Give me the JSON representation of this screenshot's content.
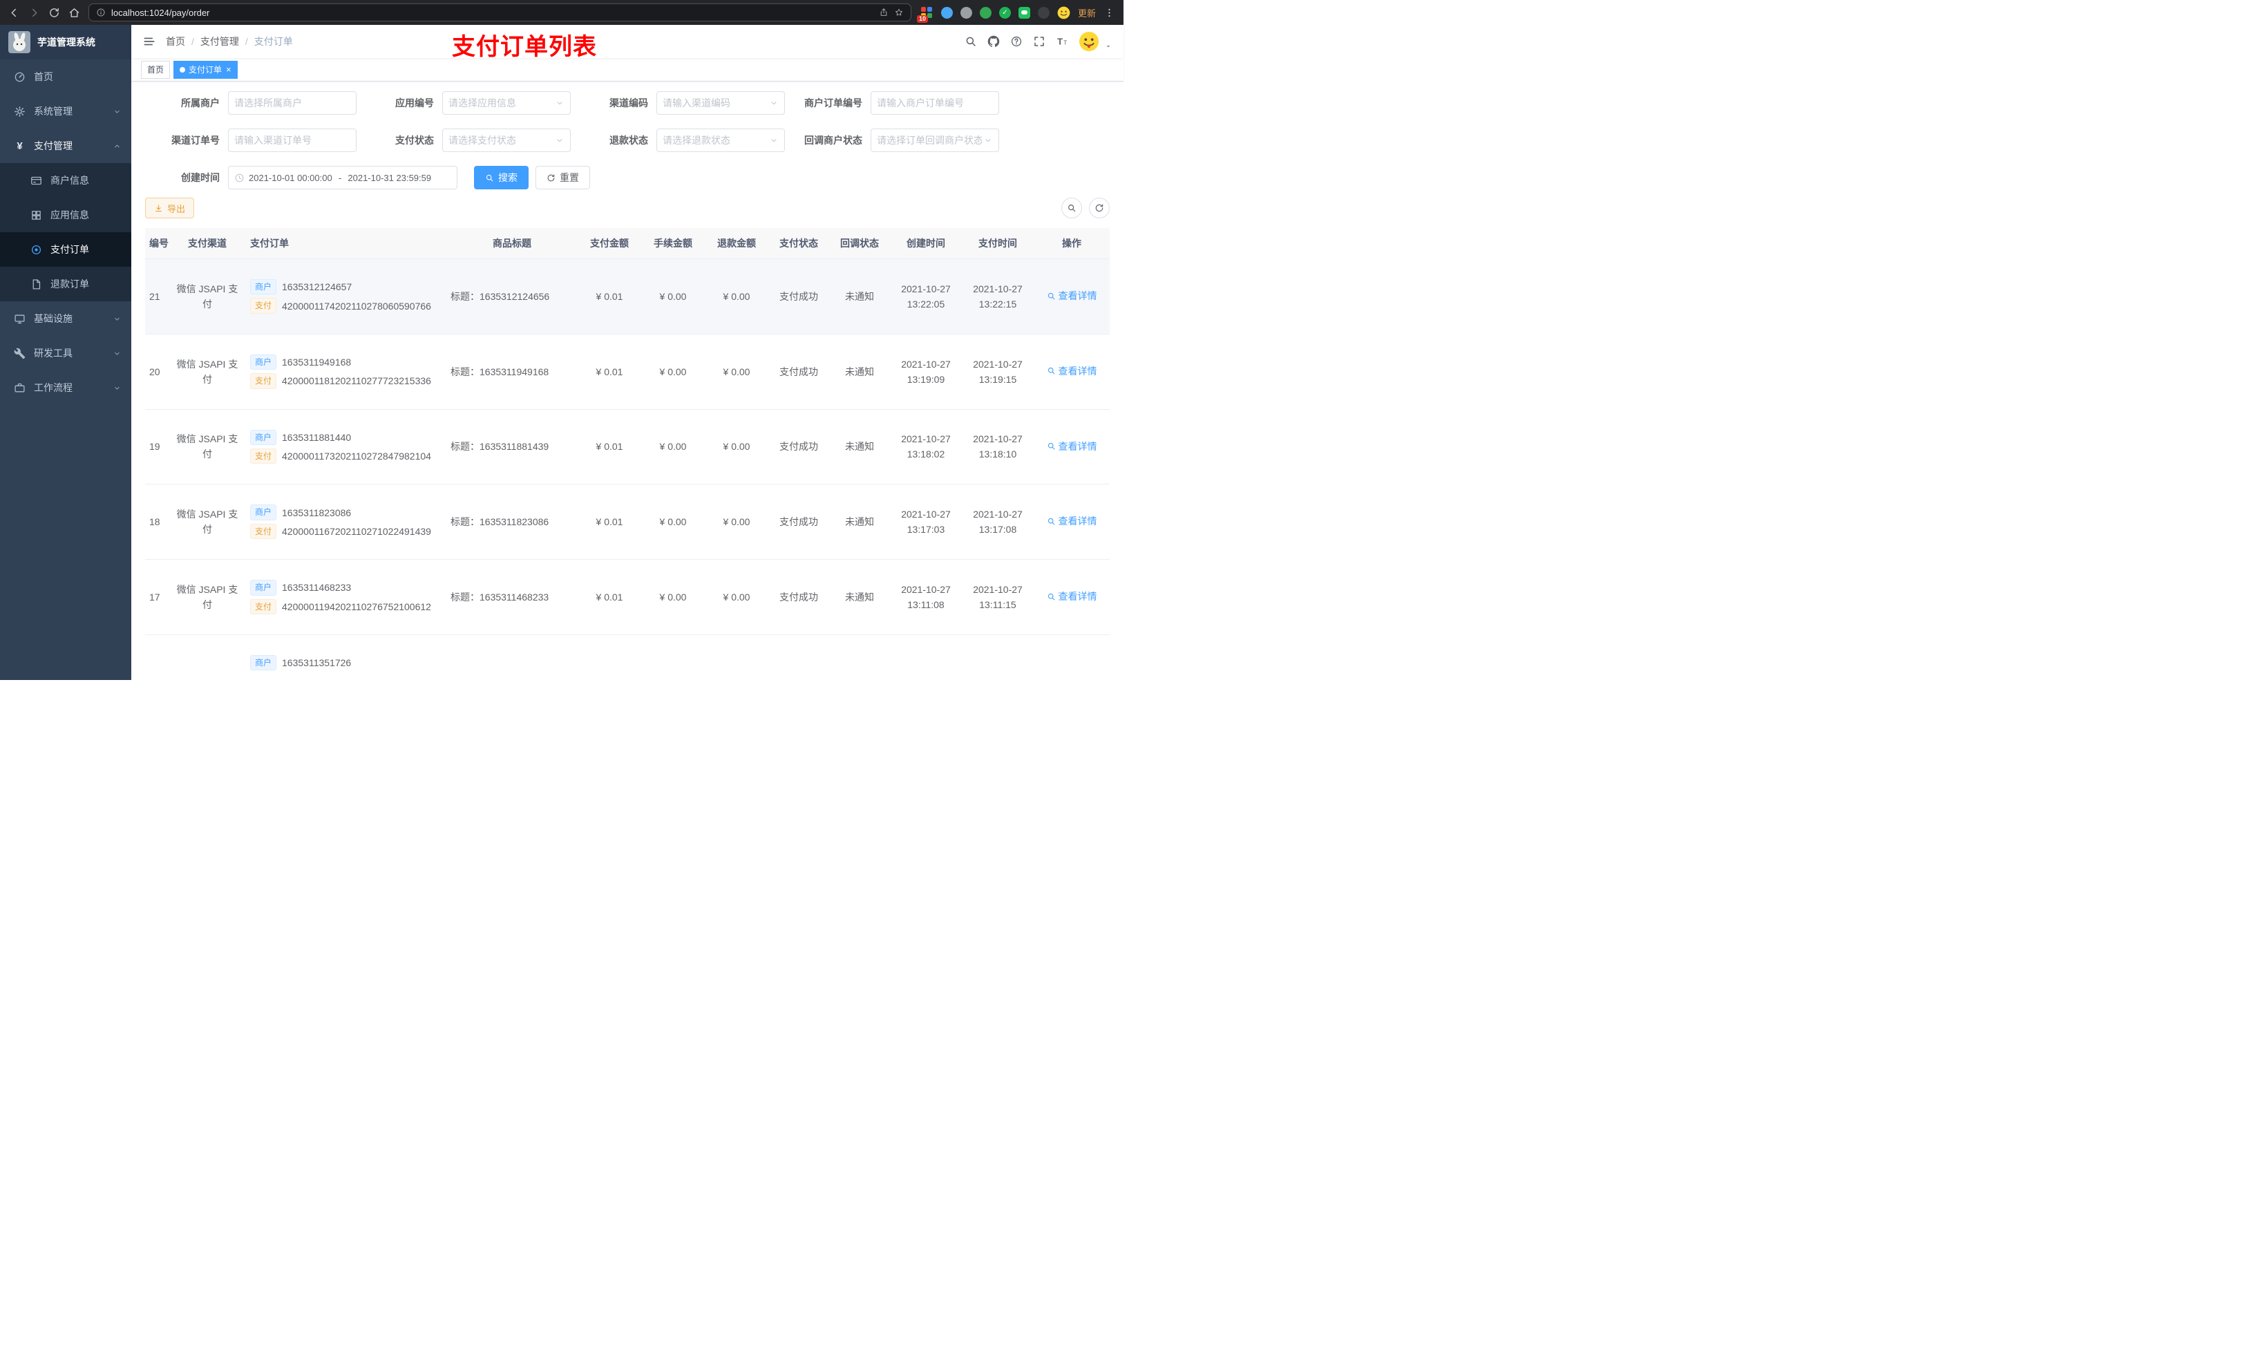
{
  "icons": {
    "yen": "¥",
    "close": "×",
    "check": "✓"
  },
  "browser": {
    "url": "localhost:1024/pay/order",
    "update_label": "更新",
    "extension_badge": "10"
  },
  "app": {
    "title": "芋道管理系统"
  },
  "sidebar": {
    "menu": [
      {
        "label": "首页"
      },
      {
        "label": "系统管理"
      },
      {
        "label": "支付管理"
      },
      {
        "label": "基础设施"
      },
      {
        "label": "研发工具"
      },
      {
        "label": "工作流程"
      }
    ],
    "submenu": [
      {
        "label": "商户信息"
      },
      {
        "label": "应用信息"
      },
      {
        "label": "支付订单"
      },
      {
        "label": "退款订单"
      }
    ]
  },
  "navbar": {
    "breadcrumb": [
      "首页",
      "支付管理",
      "支付订单"
    ],
    "sep": "/",
    "annotation": "支付订单列表"
  },
  "tags": {
    "items": [
      {
        "label": "首页"
      },
      {
        "label": "支付订单"
      }
    ]
  },
  "filters": {
    "row1": [
      {
        "label": "所属商户",
        "placeholder": "请选择所属商户"
      },
      {
        "label": "应用编号",
        "placeholder": "请选择应用信息"
      },
      {
        "label": "渠道编码",
        "placeholder": "请输入渠道编码"
      },
      {
        "label": "商户订单编号",
        "placeholder": "请输入商户订单编号"
      }
    ],
    "row2": [
      {
        "label": "渠道订单号",
        "placeholder": "请输入渠道订单号"
      },
      {
        "label": "支付状态",
        "placeholder": "请选择支付状态"
      },
      {
        "label": "退款状态",
        "placeholder": "请选择退款状态"
      },
      {
        "label": "回调商户状态",
        "placeholder": "请选择订单回调商户状态"
      }
    ],
    "date_label": "创建时间",
    "date_start": "2021-10-01 00:00:00",
    "date_separator": "-",
    "date_end": "2021-10-31 23:59:59",
    "search_label": "搜索",
    "reset_label": "重置"
  },
  "toolbar": {
    "export_label": "导出"
  },
  "table": {
    "columns": [
      "编号",
      "支付渠道",
      "支付订单",
      "商品标题",
      "支付金额",
      "手续金额",
      "退款金额",
      "支付状态",
      "回调状态",
      "创建时间",
      "支付时间",
      "操作"
    ],
    "tag_merchant": "商户",
    "tag_pay": "支付",
    "action_label": "查看详情",
    "rows": [
      {
        "id": "21",
        "channel": "微信 JSAPI 支付",
        "merchant_no": "1635312124657",
        "channel_no": "4200001174202110278060590766",
        "subject": "标题：1635312124656",
        "amount": "¥ 0.01",
        "fee": "¥ 0.00",
        "refund": "¥ 0.00",
        "status": "支付成功",
        "notify": "未通知",
        "create_time": "2021-10-27 13:22:05",
        "pay_time": "2021-10-27 13:22:15"
      },
      {
        "id": "20",
        "channel": "微信 JSAPI 支付",
        "merchant_no": "1635311949168",
        "channel_no": "4200001181202110277723215336",
        "subject": "标题：1635311949168",
        "amount": "¥ 0.01",
        "fee": "¥ 0.00",
        "refund": "¥ 0.00",
        "status": "支付成功",
        "notify": "未通知",
        "create_time": "2021-10-27 13:19:09",
        "pay_time": "2021-10-27 13:19:15"
      },
      {
        "id": "19",
        "channel": "微信 JSAPI 支付",
        "merchant_no": "1635311881440",
        "channel_no": "4200001173202110272847982104",
        "subject": "标题：1635311881439",
        "amount": "¥ 0.01",
        "fee": "¥ 0.00",
        "refund": "¥ 0.00",
        "status": "支付成功",
        "notify": "未通知",
        "create_time": "2021-10-27 13:18:02",
        "pay_time": "2021-10-27 13:18:10"
      },
      {
        "id": "18",
        "channel": "微信 JSAPI 支付",
        "merchant_no": "1635311823086",
        "channel_no": "4200001167202110271022491439",
        "subject": "标题：1635311823086",
        "amount": "¥ 0.01",
        "fee": "¥ 0.00",
        "refund": "¥ 0.00",
        "status": "支付成功",
        "notify": "未通知",
        "create_time": "2021-10-27 13:17:03",
        "pay_time": "2021-10-27 13:17:08"
      },
      {
        "id": "17",
        "channel": "微信 JSAPI 支付",
        "merchant_no": "1635311468233",
        "channel_no": "4200001194202110276752100612",
        "subject": "标题：1635311468233",
        "amount": "¥ 0.01",
        "fee": "¥ 0.00",
        "refund": "¥ 0.00",
        "status": "支付成功",
        "notify": "未通知",
        "create_time": "2021-10-27 13:11:08",
        "pay_time": "2021-10-27 13:11:15"
      },
      {
        "id": "",
        "channel": "",
        "merchant_no": "1635311351726",
        "channel_no": "",
        "subject": "",
        "amount": "",
        "fee": "",
        "refund": "",
        "status": "",
        "notify": "",
        "create_time": "",
        "pay_time": ""
      }
    ]
  }
}
